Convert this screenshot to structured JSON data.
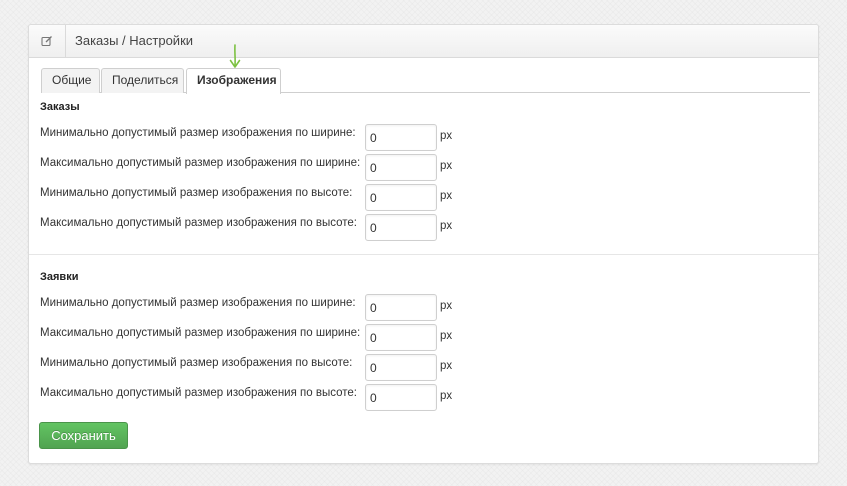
{
  "header": {
    "icon": "edit-icon",
    "title": "Заказы / Настройки"
  },
  "tabs": [
    {
      "label": "Общие",
      "active": false
    },
    {
      "label": "Поделиться",
      "active": false
    },
    {
      "label": "Изображения",
      "active": true
    }
  ],
  "sections": [
    {
      "title": "Заказы",
      "rows": [
        {
          "label": "Минимально допустимый размер изображения по ширине:",
          "value": "0",
          "unit": "px"
        },
        {
          "label": "Максимально допустимый размер изображения по ширине:",
          "value": "0",
          "unit": "px"
        },
        {
          "label": "Минимально допустимый размер изображения по высоте:",
          "value": "0",
          "unit": "px"
        },
        {
          "label": "Максимально допустимый размер изображения по высоте:",
          "value": "0",
          "unit": "px"
        }
      ]
    },
    {
      "title": "Заявки",
      "rows": [
        {
          "label": "Минимально допустимый размер изображения по ширине:",
          "value": "0",
          "unit": "px"
        },
        {
          "label": "Максимально допустимый размер изображения по ширине:",
          "value": "0",
          "unit": "px"
        },
        {
          "label": "Минимально допустимый размер изображения по высоте:",
          "value": "0",
          "unit": "px"
        },
        {
          "label": "Максимально допустимый размер изображения по высоте:",
          "value": "0",
          "unit": "px"
        }
      ]
    }
  ],
  "save_button": {
    "label": "Сохранить",
    "color": "#5bb75b"
  },
  "arrow_color": "#7cc142"
}
